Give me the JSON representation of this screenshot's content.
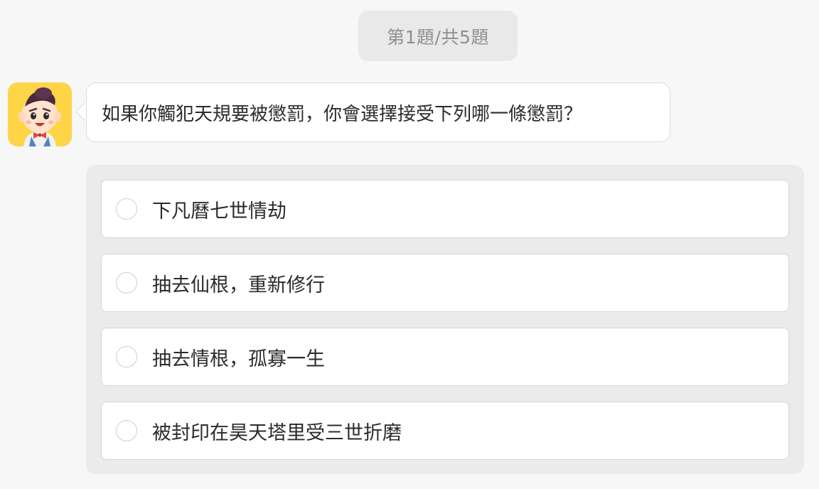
{
  "progress": {
    "label": "第1題/共5題"
  },
  "question": {
    "text": "如果你觸犯天規要被懲罰，你會選擇接受下列哪一條懲罰？"
  },
  "options": [
    {
      "label": "下凡曆七世情劫"
    },
    {
      "label": "抽去仙根，重新修行"
    },
    {
      "label": "抽去情根，孤寡一生"
    },
    {
      "label": "被封印在昊天塔里受三世折磨"
    }
  ],
  "colors": {
    "background": "#f7f7f7",
    "avatar_bg": "#ffd548",
    "panel_bg": "#ebebeb",
    "text": "#2b2b2b",
    "pill_text": "#8f8f8f"
  },
  "icons": {
    "avatar": "cartoon-boy-avatar-icon",
    "radio": "radio-unchecked-icon"
  }
}
